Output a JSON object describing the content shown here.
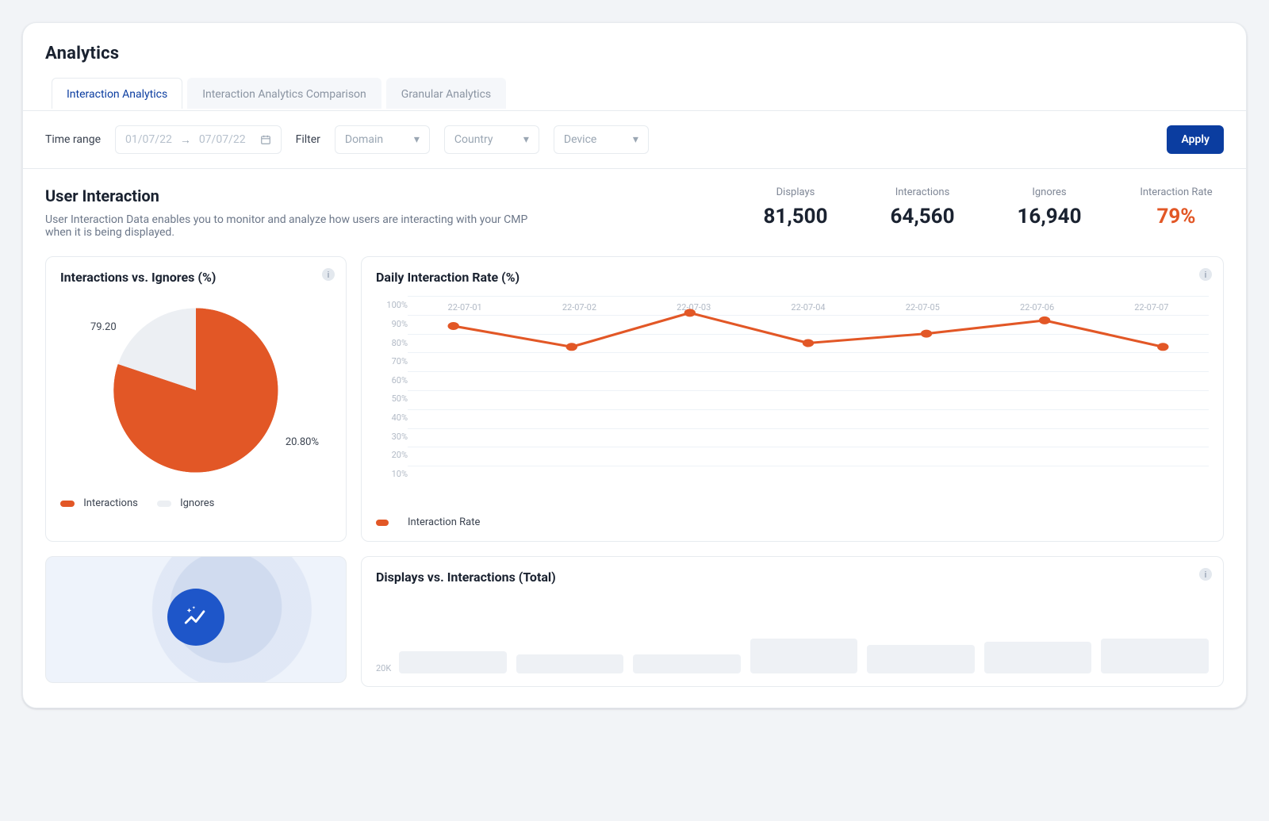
{
  "header": {
    "title": "Analytics"
  },
  "tabs": [
    {
      "label": "Interaction Analytics",
      "active": true
    },
    {
      "label": "Interaction Analytics Comparison",
      "active": false
    },
    {
      "label": "Granular Analytics",
      "active": false
    }
  ],
  "filters": {
    "time_range_label": "Time range",
    "date_from": "01/07/22",
    "date_to": "07/07/22",
    "filter_label": "Filter",
    "dropdowns": {
      "domain": "Domain",
      "country": "Country",
      "device": "Device"
    },
    "apply_label": "Apply"
  },
  "section": {
    "title": "User Interaction",
    "description": "User Interaction Data enables you to monitor and analyze how users are interacting with your CMP when it is being displayed."
  },
  "kpis": [
    {
      "label": "Displays",
      "value": "81,500"
    },
    {
      "label": "Interactions",
      "value": "64,560"
    },
    {
      "label": "Ignores",
      "value": "16,940"
    },
    {
      "label": "Interaction Rate",
      "value": "79%",
      "accent": true
    }
  ],
  "pie": {
    "title": "Interactions vs. Ignores (%)",
    "legend": {
      "a": "Interactions",
      "b": "Ignores"
    },
    "label_a": "79.20",
    "label_b": "20.80%"
  },
  "line": {
    "title": "Daily Interaction Rate (%)",
    "legend": "Interaction Rate"
  },
  "lower_right": {
    "title": "Displays vs. Interactions (Total)",
    "ytick": "20K"
  },
  "colors": {
    "accent": "#e25726",
    "primary": "#0b3da0",
    "gray": "#eceff3"
  },
  "chart_data": [
    {
      "id": "interactions-vs-ignores",
      "type": "pie",
      "title": "Interactions vs. Ignores (%)",
      "series": [
        {
          "name": "Interactions",
          "value": 79.2,
          "color": "#e25726"
        },
        {
          "name": "Ignores",
          "value": 20.8,
          "color": "#eceff3"
        }
      ],
      "annotations": [
        "79.20",
        "20.80%"
      ],
      "legend": {
        "position": "bottom",
        "entries": [
          "Interactions",
          "Ignores"
        ]
      }
    },
    {
      "id": "daily-interaction-rate",
      "type": "line",
      "title": "Daily Interaction Rate (%)",
      "xlabel": "",
      "ylabel": "",
      "ylim": [
        0,
        100
      ],
      "yticks": [
        0,
        10,
        20,
        30,
        40,
        50,
        60,
        70,
        80,
        90,
        100
      ],
      "yticklabels": [
        "",
        "10%",
        "20%",
        "30%",
        "40%",
        "50%",
        "60%",
        "70%",
        "80%",
        "90%",
        "100%"
      ],
      "categories": [
        "22-07-01",
        "22-07-02",
        "22-07-03",
        "22-07-04",
        "22-07-05",
        "22-07-06",
        "22-07-07"
      ],
      "series": [
        {
          "name": "Interaction Rate",
          "values": [
            84,
            73,
            91,
            75,
            80,
            87,
            73
          ],
          "color": "#e25726"
        }
      ],
      "grid": true,
      "legend": {
        "position": "bottom",
        "entries": [
          "Interaction Rate"
        ]
      }
    },
    {
      "id": "displays-vs-interactions-total",
      "type": "bar",
      "title": "Displays vs. Interactions (Total)",
      "ylim": [
        0,
        20000
      ],
      "yticks": [
        20000
      ],
      "yticklabels": [
        "20K"
      ],
      "categories": [
        "22-07-01",
        "22-07-02",
        "22-07-03",
        "22-07-04",
        "22-07-05",
        "22-07-06",
        "22-07-07"
      ],
      "values": [
        12000,
        11000,
        11000,
        18500,
        15500,
        17000,
        18500
      ],
      "note": "Estimated from partially visible grouped/paired bars (heights approximate).",
      "grid": false
    }
  ]
}
